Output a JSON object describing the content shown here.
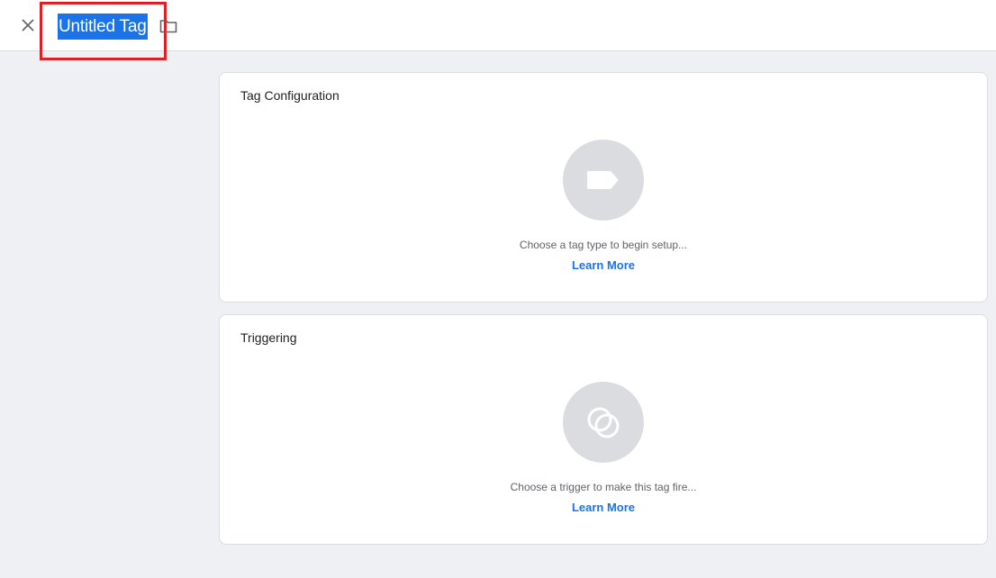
{
  "header": {
    "close_icon": "close-icon",
    "title": "Untitled Tag",
    "folder_icon": "folder-icon"
  },
  "tag_configuration": {
    "title": "Tag Configuration",
    "icon": "tag-icon",
    "hint": "Choose a tag type to begin setup...",
    "learn_more": "Learn More"
  },
  "triggering": {
    "title": "Triggering",
    "icon": "trigger-icon",
    "hint": "Choose a trigger to make this tag fire...",
    "learn_more": "Learn More"
  },
  "colors": {
    "accent": "#1a73e8",
    "highlight_box": "#e01e26",
    "page_bg": "#eff0f3",
    "icon_circle": "#dadce0"
  }
}
